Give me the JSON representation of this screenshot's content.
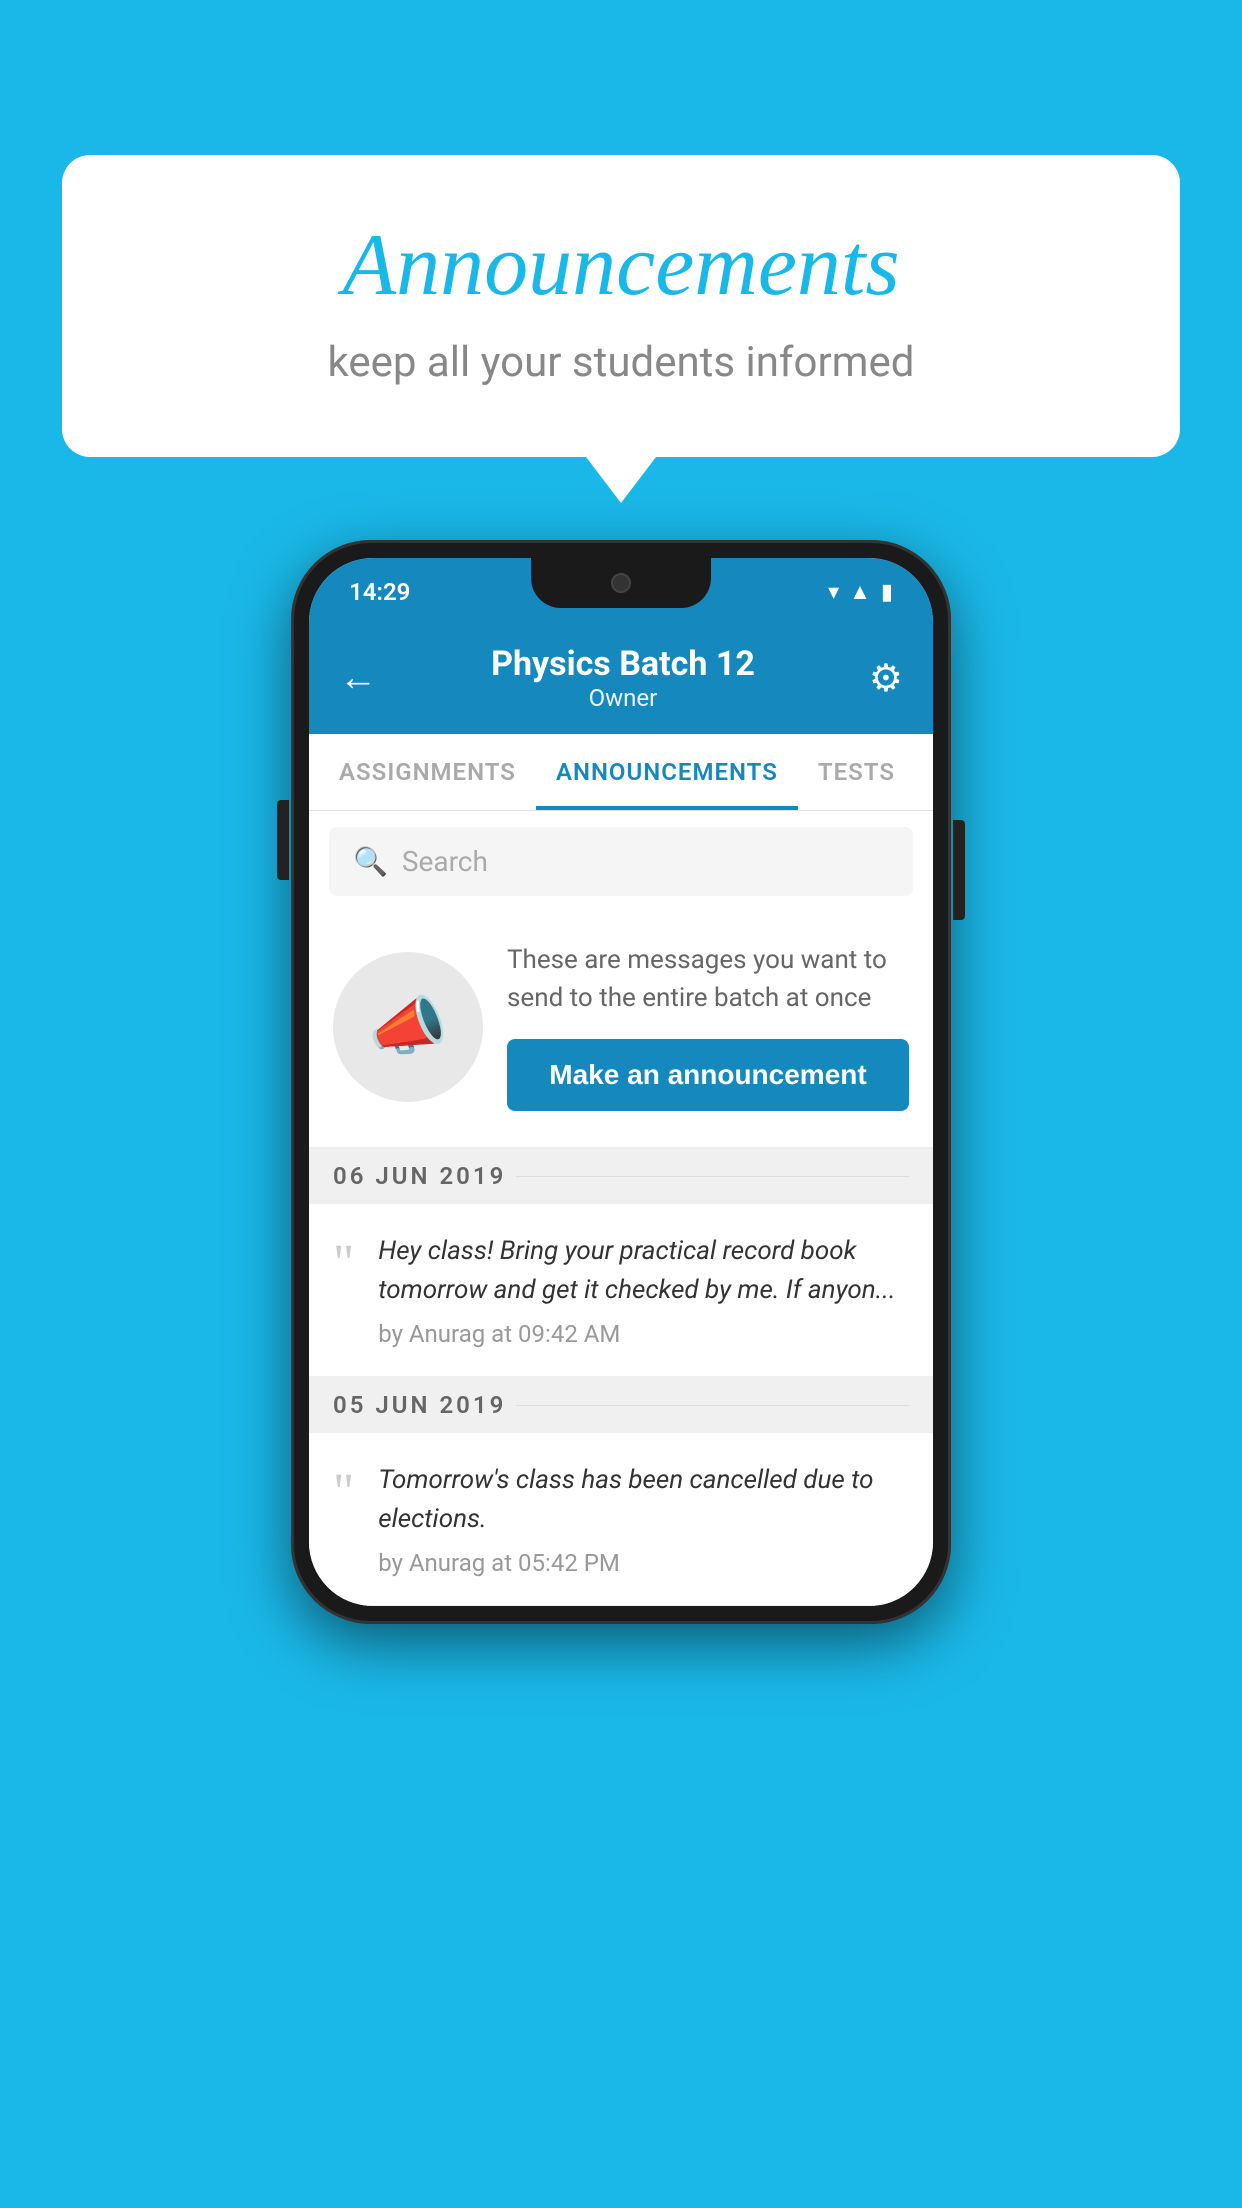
{
  "background_color": "#1ab8e8",
  "speech_bubble": {
    "title": "Announcements",
    "subtitle": "keep all your students informed"
  },
  "phone": {
    "status_bar": {
      "time": "14:29",
      "icons": [
        "wifi",
        "signal",
        "battery"
      ]
    },
    "header": {
      "title": "Physics Batch 12",
      "subtitle": "Owner",
      "back_label": "←",
      "gear_label": "⚙"
    },
    "tabs": [
      {
        "label": "ASSIGNMENTS",
        "active": false
      },
      {
        "label": "ANNOUNCEMENTS",
        "active": true
      },
      {
        "label": "TESTS",
        "active": false
      }
    ],
    "search": {
      "placeholder": "Search"
    },
    "promo": {
      "description": "These are messages you want to send to the entire batch at once",
      "button_label": "Make an announcement"
    },
    "announcements": [
      {
        "date": "06  JUN  2019",
        "items": [
          {
            "text": "Hey class! Bring your practical record book tomorrow and get it checked by me. If anyon...",
            "meta": "by Anurag at 09:42 AM"
          }
        ]
      },
      {
        "date": "05  JUN  2019",
        "items": [
          {
            "text": "Tomorrow's class has been cancelled due to elections.",
            "meta": "by Anurag at 05:42 PM"
          }
        ]
      }
    ]
  }
}
